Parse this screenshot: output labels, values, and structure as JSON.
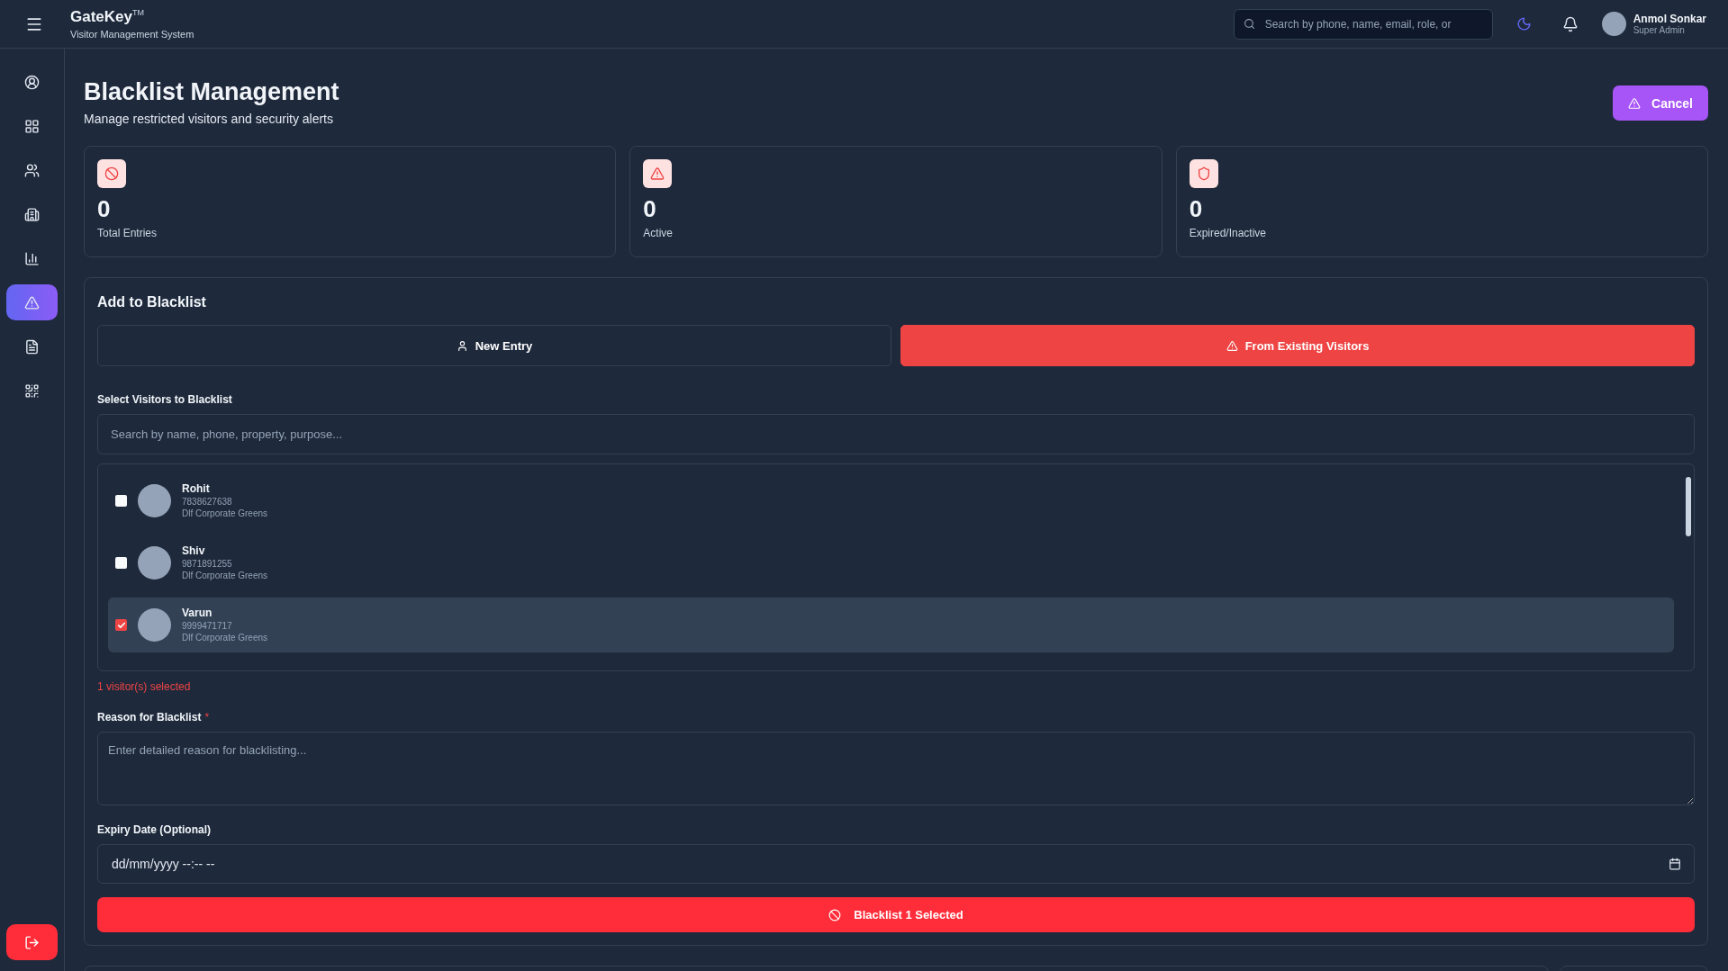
{
  "header": {
    "brand": "GateKey",
    "trademark": "TM",
    "subtitle": "Visitor Management System",
    "search": {
      "placeholder": "Search by phone, name, email, role, or"
    },
    "user": {
      "name": "Anmol Sonkar",
      "role": "Super Admin"
    }
  },
  "sidebar": {
    "items": [
      {
        "selected": false
      },
      {
        "selected": false
      },
      {
        "selected": false
      },
      {
        "selected": false
      },
      {
        "selected": false
      },
      {
        "selected": true
      },
      {
        "selected": false
      },
      {
        "selected": false
      }
    ]
  },
  "page": {
    "title": "Blacklist Management",
    "subtitle": "Manage restricted visitors and security alerts",
    "cancel_button": "Cancel"
  },
  "stats": [
    {
      "value": "0",
      "label": "Total Entries"
    },
    {
      "value": "0",
      "label": "Active"
    },
    {
      "value": "0",
      "label": "Expired/Inactive"
    }
  ],
  "form": {
    "title": "Add to Blacklist",
    "tabs": [
      {
        "label": "New Entry",
        "selected": false
      },
      {
        "label": "From Existing Visitors",
        "selected": true
      }
    ],
    "select_label": "Select Visitors to Blacklist",
    "search": {
      "placeholder": "Search by name, phone, property, purpose..."
    },
    "visitors": [
      {
        "name": "Rohit",
        "phone": "7838627638",
        "property": "Dlf Corporate Greens",
        "checked": false
      },
      {
        "name": "Shiv",
        "phone": "9871891255",
        "property": "Dlf Corporate Greens",
        "checked": false
      },
      {
        "name": "Varun",
        "phone": "9999471717",
        "property": "Dlf Corporate Greens",
        "checked": true
      }
    ],
    "selected_count": "1 visitor(s) selected",
    "reason": {
      "label": "Reason for Blacklist",
      "required_mark": "*",
      "placeholder": "Enter detailed reason for blacklisting..."
    },
    "expiry": {
      "label": "Expiry Date (Optional)",
      "placeholder": "dd/mm/yyyy --:-- --"
    },
    "submit_button": "Blacklist 1 Selected"
  }
}
